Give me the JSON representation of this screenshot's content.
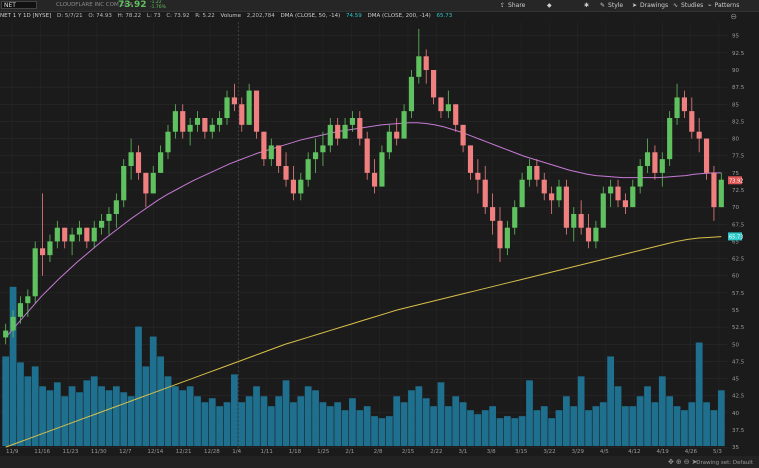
{
  "header": {
    "symbol": "NET",
    "company": "CLOUDFLARE INC COM CL A",
    "last_price": "73.92",
    "change_line1": "-1.22",
    "change_line2": "-1.76%",
    "tools": [
      {
        "name": "share",
        "icon": "share-icon",
        "label": "Share"
      },
      {
        "name": "alert",
        "icon": "bell-icon",
        "label": ""
      },
      {
        "name": "gear",
        "icon": "gear-icon",
        "label": ""
      },
      {
        "name": "style",
        "icon": "style-icon",
        "label": "Style"
      },
      {
        "name": "drawings",
        "icon": "pencil-icon",
        "label": "Drawings"
      },
      {
        "name": "studies",
        "icon": "studies-icon",
        "label": "Studies"
      },
      {
        "name": "patterns",
        "icon": "patterns-icon",
        "label": "Patterns"
      }
    ]
  },
  "info": {
    "title": "NET 1 Y 1D [NYSE]",
    "date": "D: 5/7/21",
    "open": "O: 74.93",
    "high": "H: 78.22",
    "low": "L: 73",
    "close": "C: 73.92",
    "change": "R: 5.22",
    "volume_label": "Volume",
    "volume_value": "2,202,784",
    "dma50_label": "DMA (CLOSE, 50, -14)",
    "dma50_value": "74.59",
    "dma200_label": "DMA (CLOSE, 200, -14)",
    "dma200_value": "65.73"
  },
  "footer": {
    "drawing_set": "Drawing set: Default"
  },
  "chart_data": {
    "type": "candlestick",
    "yaxis_ticks": [
      "95",
      "92.5",
      "90",
      "87.5",
      "85",
      "82.5",
      "80",
      "77.5",
      "75",
      "72.5",
      "70",
      "67.5",
      "65",
      "62.5",
      "60",
      "57.5",
      "55",
      "52.5",
      "50",
      "47.5",
      "45",
      "42.5",
      "40",
      "37.5",
      "35"
    ],
    "ylim": [
      34,
      97
    ],
    "x_tick_labels": [
      "11/9",
      "11/16",
      "11/23",
      "11/30",
      "12/7",
      "12/14",
      "12/21",
      "12/28",
      "1/4",
      "1/11",
      "1/18",
      "1/25",
      "2/1",
      "2/8",
      "2/15",
      "2/22",
      "3/1",
      "3/8",
      "3/15",
      "3/22",
      "3/29",
      "4/5",
      "4/12",
      "4/19",
      "4/26",
      "5/3"
    ],
    "price_tags": [
      {
        "label": "73.92",
        "value": 73.92,
        "color": "#e05454"
      },
      {
        "label": "65.73",
        "value": 65.73,
        "color": "#2ec8c8"
      }
    ],
    "colors": {
      "up": "#5fc15f",
      "down": "#f08080",
      "volume": "#1f6f8f",
      "dma50": "#c77ad6",
      "dma200": "#d9c04a"
    },
    "candles_ohlc": [
      [
        51,
        53,
        50,
        52
      ],
      [
        52,
        55,
        51,
        54
      ],
      [
        54,
        57,
        53,
        56
      ],
      [
        56,
        58,
        54,
        57
      ],
      [
        57,
        65,
        56,
        64
      ],
      [
        64,
        72,
        60,
        63
      ],
      [
        63,
        66,
        62,
        65
      ],
      [
        65,
        68,
        64,
        67
      ],
      [
        67,
        67,
        64,
        65
      ],
      [
        65,
        67,
        63,
        66
      ],
      [
        66,
        68,
        65,
        67
      ],
      [
        67,
        67,
        64,
        65
      ],
      [
        65,
        68,
        64,
        67
      ],
      [
        67,
        69,
        66,
        68
      ],
      [
        68,
        70,
        66,
        69
      ],
      [
        69,
        72,
        67,
        71
      ],
      [
        71,
        77,
        70,
        76
      ],
      [
        76,
        80,
        74,
        78
      ],
      [
        78,
        79,
        74,
        75
      ],
      [
        75,
        75,
        70,
        72
      ],
      [
        72,
        76,
        72,
        75
      ],
      [
        75,
        79,
        75,
        78
      ],
      [
        78,
        82,
        77,
        81
      ],
      [
        81,
        85,
        80,
        84
      ],
      [
        84,
        85,
        80,
        81
      ],
      [
        81,
        83,
        79,
        82
      ],
      [
        82,
        84,
        81,
        83
      ],
      [
        83,
        83,
        80,
        81
      ],
      [
        81,
        83,
        80,
        82
      ],
      [
        82,
        84,
        81,
        83
      ],
      [
        83,
        87,
        82,
        86
      ],
      [
        86,
        88,
        84,
        85
      ],
      [
        85,
        86,
        81,
        82
      ],
      [
        82,
        88,
        82,
        87
      ],
      [
        87,
        87,
        80,
        81
      ],
      [
        81,
        81,
        76,
        77
      ],
      [
        77,
        80,
        76,
        79
      ],
      [
        79,
        79,
        75,
        76
      ],
      [
        76,
        78,
        73,
        74
      ],
      [
        74,
        76,
        71,
        72
      ],
      [
        72,
        75,
        71,
        74
      ],
      [
        74,
        78,
        73,
        77
      ],
      [
        77,
        80,
        75,
        78
      ],
      [
        78,
        81,
        76,
        79
      ],
      [
        79,
        83,
        78,
        82
      ],
      [
        82,
        83,
        79,
        80
      ],
      [
        80,
        83,
        80,
        82
      ],
      [
        82,
        84,
        81,
        83
      ],
      [
        83,
        84,
        79,
        80
      ],
      [
        80,
        81,
        74,
        75
      ],
      [
        75,
        77,
        72,
        73
      ],
      [
        73,
        79,
        73,
        78
      ],
      [
        78,
        82,
        77,
        81
      ],
      [
        81,
        83,
        79,
        80
      ],
      [
        80,
        85,
        80,
        84
      ],
      [
        84,
        90,
        83,
        89
      ],
      [
        89,
        96,
        88,
        92
      ],
      [
        92,
        93,
        88,
        90
      ],
      [
        90,
        90,
        85,
        86
      ],
      [
        86,
        86,
        83,
        84
      ],
      [
        84,
        87,
        83,
        85
      ],
      [
        85,
        85,
        81,
        82
      ],
      [
        82,
        82,
        78,
        79
      ],
      [
        79,
        79,
        74,
        75
      ],
      [
        75,
        77,
        72,
        74
      ],
      [
        74,
        76,
        69,
        70
      ],
      [
        70,
        72,
        66,
        68
      ],
      [
        68,
        70,
        62,
        64
      ],
      [
        64,
        68,
        63,
        67
      ],
      [
        67,
        71,
        66,
        70
      ],
      [
        70,
        75,
        70,
        74
      ],
      [
        74,
        77,
        73,
        76
      ],
      [
        76,
        77,
        73,
        74
      ],
      [
        74,
        75,
        71,
        72
      ],
      [
        72,
        73,
        69,
        71
      ],
      [
        71,
        74,
        70,
        73
      ],
      [
        73,
        74,
        66,
        67
      ],
      [
        67,
        70,
        65,
        69
      ],
      [
        69,
        71,
        66,
        67
      ],
      [
        67,
        69,
        64,
        65
      ],
      [
        65,
        68,
        64,
        67
      ],
      [
        67,
        73,
        67,
        72
      ],
      [
        72,
        74,
        70,
        73
      ],
      [
        73,
        74,
        70,
        71
      ],
      [
        71,
        72,
        69,
        70
      ],
      [
        70,
        74,
        70,
        73
      ],
      [
        73,
        77,
        72,
        76
      ],
      [
        76,
        80,
        75,
        78
      ],
      [
        78,
        79,
        74,
        75
      ],
      [
        75,
        78,
        73,
        77
      ],
      [
        77,
        84,
        76,
        83
      ],
      [
        83,
        88,
        82,
        86
      ],
      [
        86,
        87,
        83,
        84
      ],
      [
        84,
        86,
        80,
        81
      ],
      [
        81,
        83,
        78,
        80
      ],
      [
        80,
        80,
        74,
        75
      ],
      [
        75,
        76,
        68,
        70
      ],
      [
        70,
        75,
        70,
        74
      ]
    ],
    "dma50": [
      51,
      52.5,
      54,
      55.5,
      57,
      58.3,
      59.6,
      60.8,
      62,
      63.1,
      64.2,
      65.3,
      66.3,
      67.3,
      68.3,
      69.2,
      70.1,
      71,
      71.8,
      72.5,
      73.2,
      73.9,
      74.5,
      75.1,
      75.7,
      76.3,
      76.8,
      77.3,
      77.8,
      78.2,
      78.6,
      79,
      79.4,
      79.8,
      80.1,
      80.4,
      80.7,
      81,
      81.2,
      81.4,
      81.6,
      81.8,
      82,
      82.1,
      82.2,
      82.3,
      82.3,
      82.2,
      82,
      81.7,
      81.3,
      80.9,
      80.4,
      79.9,
      79.4,
      78.9,
      78.4,
      77.9,
      77.4,
      77,
      76.6,
      76.2,
      75.8,
      75.4,
      75.1,
      74.8,
      74.6,
      74.5,
      74.4,
      74.3,
      74.3,
      74.3,
      74.3,
      74.3,
      74.4,
      74.5,
      74.6,
      74.8,
      74.9,
      75,
      75
    ],
    "dma200": [
      35,
      35.6,
      36.2,
      36.8,
      37.4,
      38,
      38.6,
      39.2,
      39.8,
      40.4,
      41,
      41.6,
      42.2,
      42.8,
      43.4,
      44,
      44.6,
      45.2,
      45.8,
      46.4,
      47,
      47.6,
      48.2,
      48.8,
      49.4,
      50,
      50.5,
      51,
      51.5,
      52,
      52.5,
      53,
      53.5,
      54,
      54.5,
      55,
      55.4,
      55.8,
      56.2,
      56.6,
      57,
      57.4,
      57.8,
      58.2,
      58.6,
      59,
      59.4,
      59.8,
      60.2,
      60.6,
      61,
      61.4,
      61.8,
      62.2,
      62.6,
      63,
      63.4,
      63.8,
      64.2,
      64.6,
      65,
      65.3,
      65.5,
      65.6,
      65.7
    ],
    "volume_relative": [
      0.45,
      0.8,
      0.42,
      0.35,
      0.4,
      0.3,
      0.28,
      0.32,
      0.25,
      0.3,
      0.27,
      0.33,
      0.35,
      0.3,
      0.28,
      0.3,
      0.27,
      0.25,
      0.6,
      0.4,
      0.55,
      0.45,
      0.35,
      0.3,
      0.28,
      0.3,
      0.25,
      0.22,
      0.24,
      0.2,
      0.22,
      0.36,
      0.22,
      0.25,
      0.3,
      0.25,
      0.2,
      0.25,
      0.33,
      0.22,
      0.25,
      0.3,
      0.28,
      0.22,
      0.2,
      0.22,
      0.18,
      0.24,
      0.18,
      0.2,
      0.15,
      0.14,
      0.15,
      0.25,
      0.22,
      0.28,
      0.3,
      0.24,
      0.2,
      0.32,
      0.2,
      0.25,
      0.22,
      0.18,
      0.16,
      0.18,
      0.2,
      0.14,
      0.15,
      0.14,
      0.15,
      0.33,
      0.18,
      0.2,
      0.14,
      0.18,
      0.25,
      0.2,
      0.35,
      0.18,
      0.2,
      0.22,
      0.45,
      0.3,
      0.2,
      0.2,
      0.25,
      0.3,
      0.22,
      0.35,
      0.25,
      0.2,
      0.18,
      0.22,
      0.52,
      0.22,
      0.18,
      0.28,
      0.2,
      0.22
    ]
  }
}
